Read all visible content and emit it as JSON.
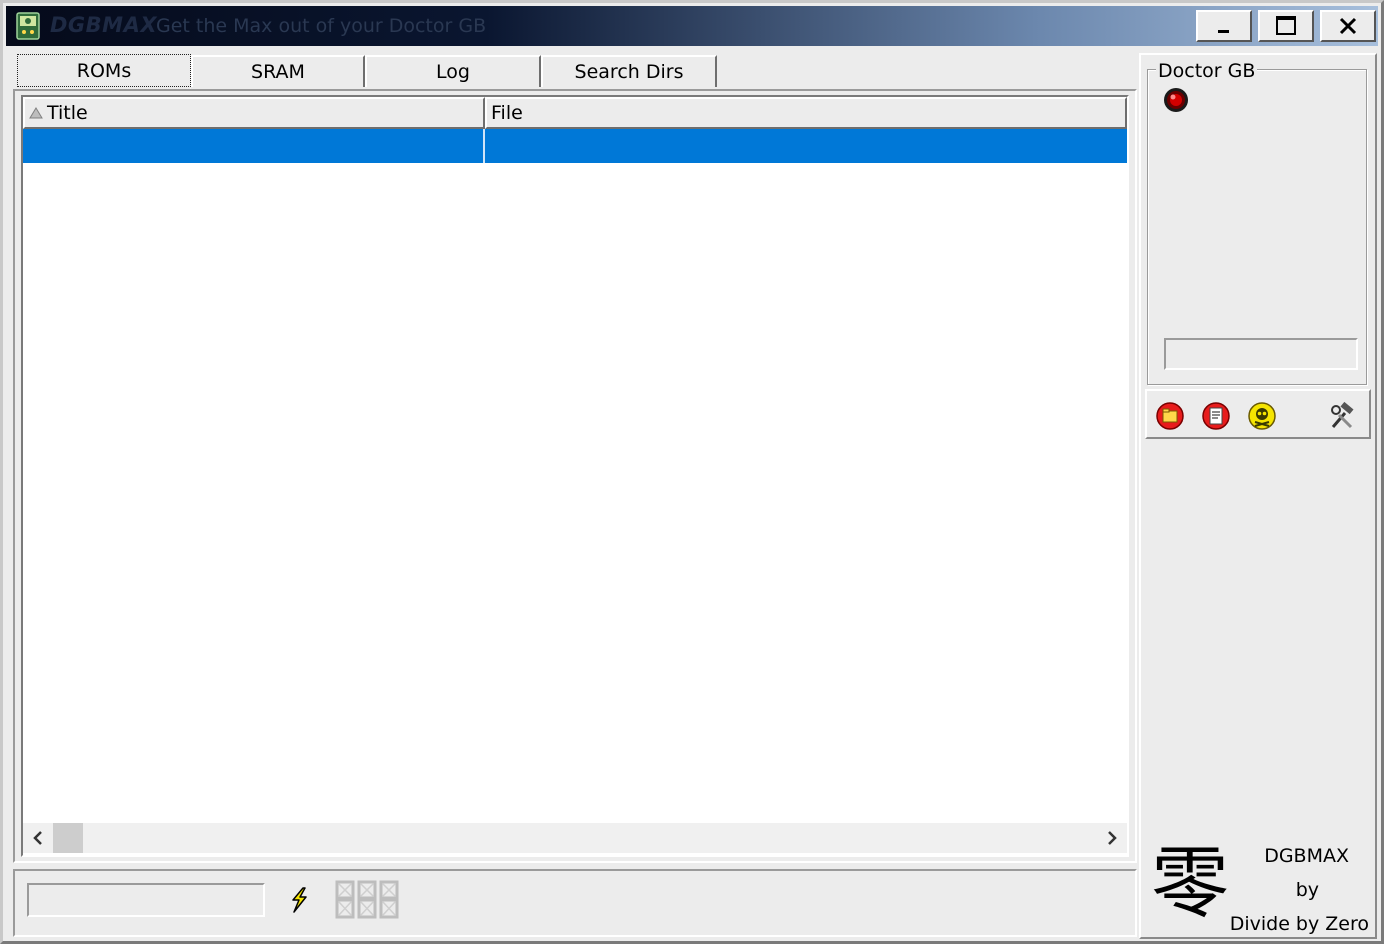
{
  "window": {
    "brand": "DGBMAX",
    "title": "Get the Max out of your Doctor GB",
    "minimize_icon": "minimize-icon",
    "maximize_icon": "maximize-icon",
    "close_icon": "close-icon"
  },
  "tabs": [
    {
      "label": "ROMs",
      "active": true
    },
    {
      "label": "SRAM",
      "active": false
    },
    {
      "label": "Log",
      "active": false
    },
    {
      "label": "Search Dirs",
      "active": false
    }
  ],
  "list": {
    "columns": [
      "Title",
      "File"
    ],
    "rows": [
      {
        "title": "",
        "file": "",
        "selected": true
      }
    ],
    "selection_color": "#0078d7"
  },
  "status": {
    "input_value": "",
    "lcd_display": "888"
  },
  "device": {
    "group_label": "Doctor GB",
    "led_color": "#cc0000",
    "input_value": "",
    "toolbar_icons": [
      "load-rom-icon",
      "write-rom-icon",
      "skull-icon",
      "tools-icon"
    ]
  },
  "branding": {
    "kanji": "零",
    "line1": "DGBMAX",
    "line2": "by",
    "line3": "Divide by Zero"
  }
}
